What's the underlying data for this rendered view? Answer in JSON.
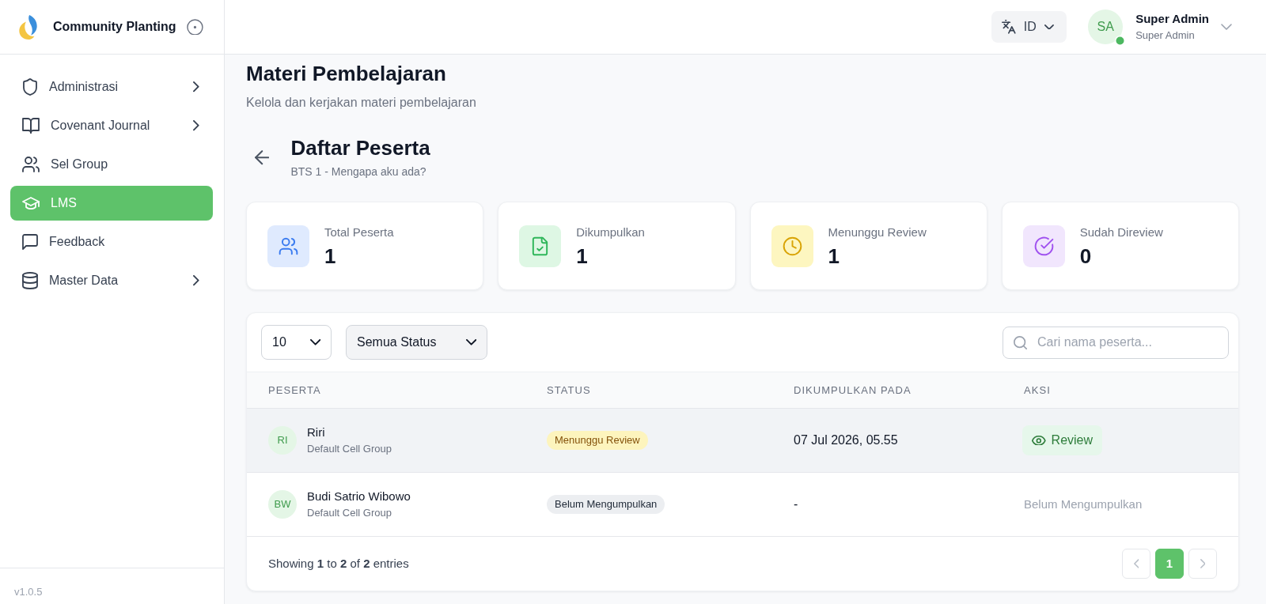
{
  "sidebar": {
    "brand": "Community Planting",
    "items": [
      {
        "label": "Administrasi",
        "kind": "admin",
        "has_submenu": true,
        "selected": false
      },
      {
        "label": "Covenant Journal",
        "kind": "journal",
        "has_submenu": true,
        "selected": false
      },
      {
        "label": "Sel Group",
        "kind": "group",
        "has_submenu": false,
        "selected": false
      },
      {
        "label": "LMS",
        "kind": "learning",
        "has_submenu": false,
        "selected": true
      },
      {
        "label": "Feedback",
        "kind": "feedback",
        "has_submenu": false,
        "selected": false
      },
      {
        "label": "Master Data",
        "kind": "data",
        "has_submenu": true,
        "selected": false
      }
    ],
    "version": "v1.0.5"
  },
  "header": {
    "language": "ID",
    "user": {
      "initials": "SA",
      "name": "Super Admin",
      "role": "Super Admin",
      "online": true
    }
  },
  "page": {
    "title": "Materi Pembelajaran",
    "subtitle": "Kelola dan kerjakan materi pembelajaran"
  },
  "section": {
    "title": "Daftar Peserta",
    "subtitle": "BTS 1 - Mengapa aku ada?"
  },
  "stats": [
    {
      "kind": "total",
      "label": "Total Peserta",
      "value": "1"
    },
    {
      "kind": "submitted",
      "label": "Dikumpulkan",
      "value": "1"
    },
    {
      "kind": "pending",
      "label": "Menunggu Review",
      "value": "1"
    },
    {
      "kind": "reviewed",
      "label": "Sudah Direview",
      "value": "0"
    }
  ],
  "table": {
    "page_size": "10",
    "status_filter": "Semua Status",
    "search": {
      "placeholder": "Cari nama peserta..."
    },
    "columns": [
      "PESERTA",
      "STATUS",
      "DIKUMPULKAN PADA",
      "AKSI"
    ],
    "rows": [
      {
        "initials": "RI",
        "name": "Riri",
        "group": "Default Cell Group",
        "status": {
          "kind": "pending",
          "label": "Menunggu Review"
        },
        "submitted_at": "07 Jul 2026, 05.55",
        "action": {
          "kind": "button",
          "label": "Review"
        },
        "hovered": true
      },
      {
        "initials": "BW",
        "name": "Budi Satrio Wibowo",
        "group": "Default Cell Group",
        "status": {
          "kind": "not_submitted",
          "label": "Belum Mengumpulkan"
        },
        "submitted_at": "-",
        "action": {
          "kind": "text",
          "label": "Belum Mengumpulkan"
        },
        "hovered": false
      }
    ]
  },
  "footer": {
    "summary": "Showing **1** to **2** of **2** entries",
    "previous": {
      "disabled": true
    },
    "pages": [
      {
        "label": "1",
        "selected": true
      }
    ],
    "next": {
      "disabled": true
    }
  }
}
